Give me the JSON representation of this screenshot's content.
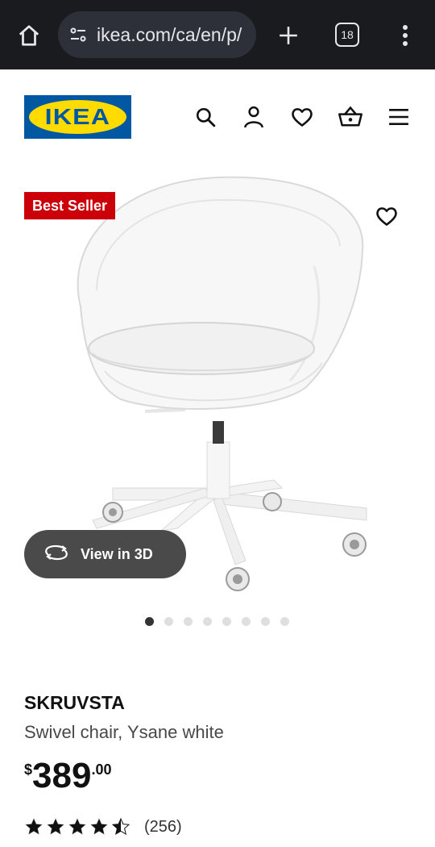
{
  "browser": {
    "url": "ikea.com/ca/en/p/",
    "tab_count": "18",
    "icons": [
      "home-icon",
      "site-settings-icon",
      "new-tab-plus-icon",
      "tab-switcher-icon",
      "more-menu-icon"
    ]
  },
  "header": {
    "logo_text": "IKEA",
    "icons": [
      "search-icon",
      "account-icon",
      "favourites-heart-icon",
      "shopping-basket-icon",
      "hamburger-menu-icon"
    ],
    "colors": {
      "brand_blue": "#0058a3",
      "brand_yellow": "#ffdb00"
    }
  },
  "product_image": {
    "badge": "Best Seller",
    "badge_color": "#cc0008",
    "view_3d_label": "View in 3D",
    "carousel": {
      "total": 8,
      "active_index": 0
    }
  },
  "product": {
    "name": "SKRUVSTA",
    "description": "Swivel chair, Ysane white",
    "price_currency": "$",
    "price_integer": "389",
    "price_decimal": ".00",
    "rating": 4.5,
    "rating_max": 5,
    "review_count": "(256)"
  }
}
